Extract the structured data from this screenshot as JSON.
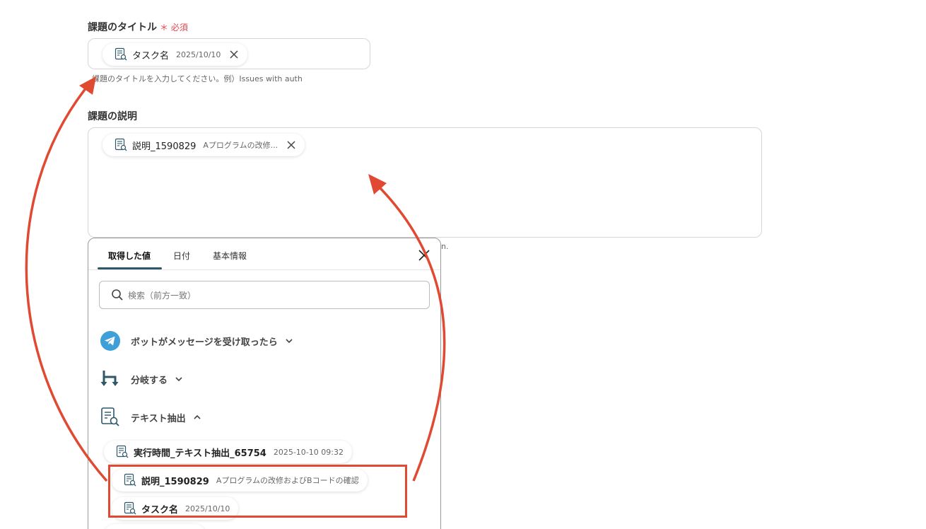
{
  "title_field": {
    "label": "課題のタイトル",
    "required_mark": "＊ 必須",
    "chip": {
      "name": "タスク名",
      "value": "2025/10/10"
    },
    "hint": "課題のタイトルを入力してください。例）Issues with auth"
  },
  "description_field": {
    "label": "課題の説明",
    "chip": {
      "name": "説明_1590829",
      "value": "Aプログラムの改修..."
    },
    "hint_tail": "n."
  },
  "picker": {
    "tabs": [
      "取得した値",
      "日付",
      "基本情報"
    ],
    "active_tab": "取得した値",
    "search_placeholder": "検索（前方一致）",
    "sections": [
      {
        "label": "ボットがメッセージを受け取ったら",
        "icon": "telegram-icon",
        "state": "collapsed"
      },
      {
        "label": "分岐する",
        "icon": "branch-icon",
        "state": "collapsed"
      },
      {
        "label": "テキスト抽出",
        "icon": "text-extract-icon",
        "state": "expanded"
      }
    ],
    "items": [
      {
        "name": "実行時間_テキスト抽出_65754",
        "value": "2025-10-10 09:32"
      },
      {
        "name": "説明_1590829",
        "value": "Aプログラムの改修およびBコードの確認"
      },
      {
        "name": "タスク名",
        "value": "2025/10/10"
      }
    ]
  },
  "colors": {
    "accent": "#2c5868",
    "required": "#e4454b",
    "annotation": "#e04a32",
    "telegram": "#3fa0d8"
  }
}
